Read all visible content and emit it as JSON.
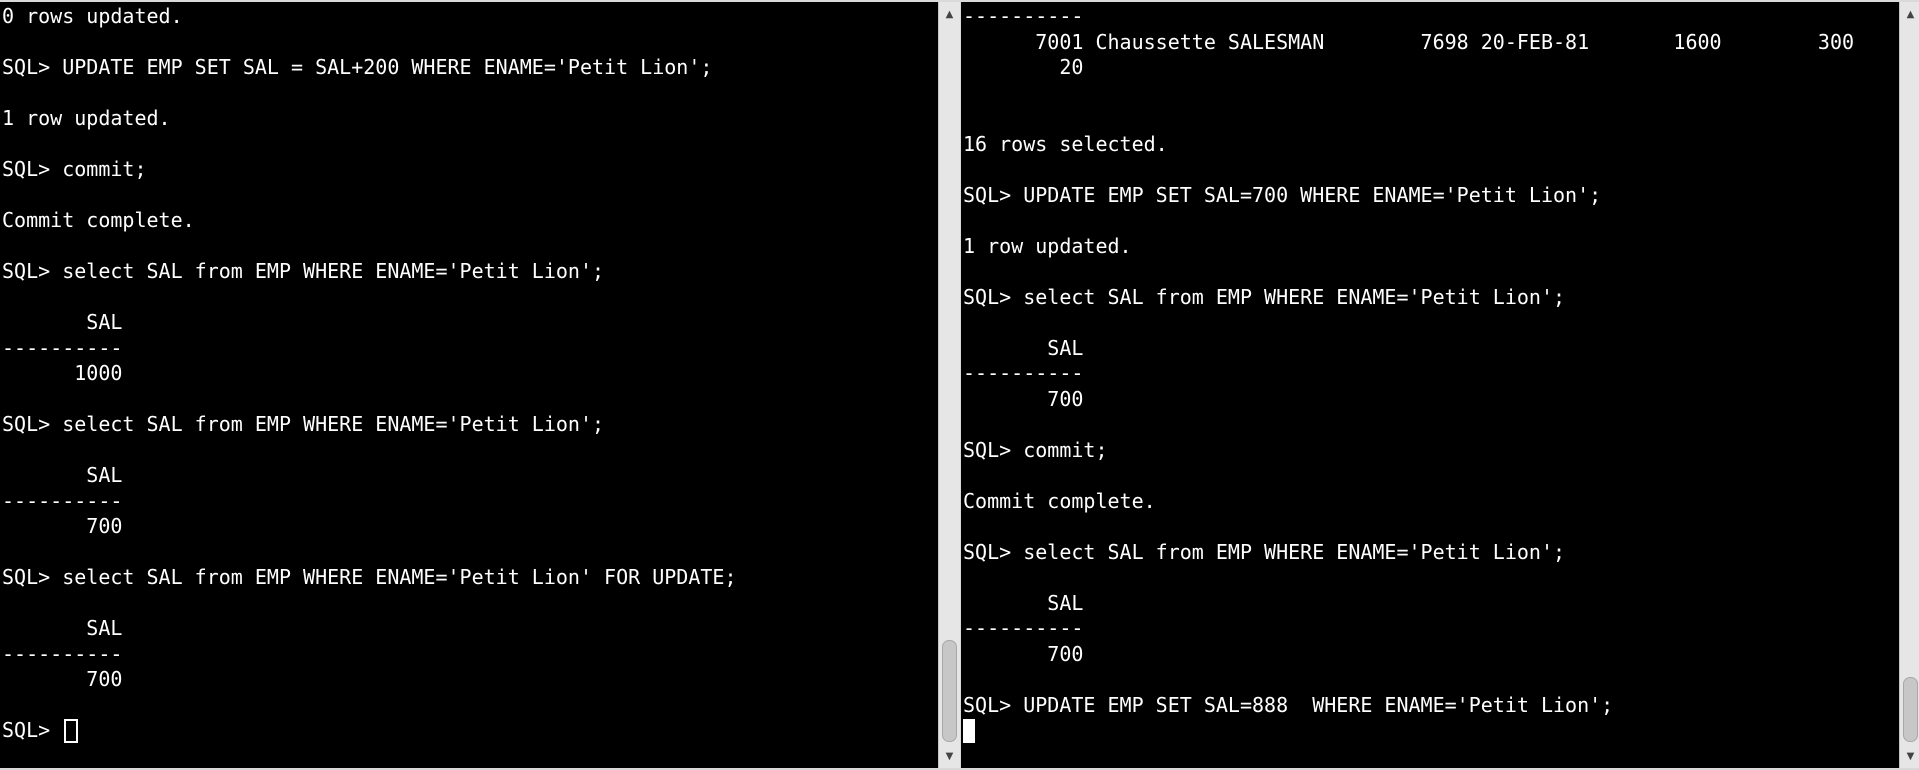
{
  "left_terminal": {
    "lines": [
      "0 rows updated.",
      "",
      "SQL> UPDATE EMP SET SAL = SAL+200 WHERE ENAME='Petit Lion';",
      "",
      "1 row updated.",
      "",
      "SQL> commit;",
      "",
      "Commit complete.",
      "",
      "SQL> select SAL from EMP WHERE ENAME='Petit Lion';",
      "",
      "       SAL",
      "----------",
      "      1000",
      "",
      "SQL> select SAL from EMP WHERE ENAME='Petit Lion';",
      "",
      "       SAL",
      "----------",
      "       700",
      "",
      "SQL> select SAL from EMP WHERE ENAME='Petit Lion' FOR UPDATE;",
      "",
      "       SAL",
      "----------",
      "       700",
      ""
    ],
    "prompt": "SQL> "
  },
  "right_terminal": {
    "lines": [
      "----------",
      "      7001 Chaussette SALESMAN        7698 20-FEB-81       1600        300",
      "        20",
      "",
      "",
      "16 rows selected.",
      "",
      "SQL> UPDATE EMP SET SAL=700 WHERE ENAME='Petit Lion';",
      "",
      "1 row updated.",
      "",
      "SQL> select SAL from EMP WHERE ENAME='Petit Lion';",
      "",
      "       SAL",
      "----------",
      "       700",
      "",
      "SQL> commit;",
      "",
      "Commit complete.",
      "",
      "SQL> select SAL from EMP WHERE ENAME='Petit Lion';",
      "",
      "       SAL",
      "----------",
      "       700",
      "",
      "SQL> UPDATE EMP SET SAL=888  WHERE ENAME='Petit Lion';"
    ]
  },
  "scrollbar": {
    "up_arrow": "▲",
    "down_arrow": "▼"
  },
  "colors": {
    "terminal_bg": "#000000",
    "terminal_fg": "#ffffff",
    "scrollbar_track": "#e6e6e6",
    "scrollbar_thumb": "#c7c7c7"
  }
}
